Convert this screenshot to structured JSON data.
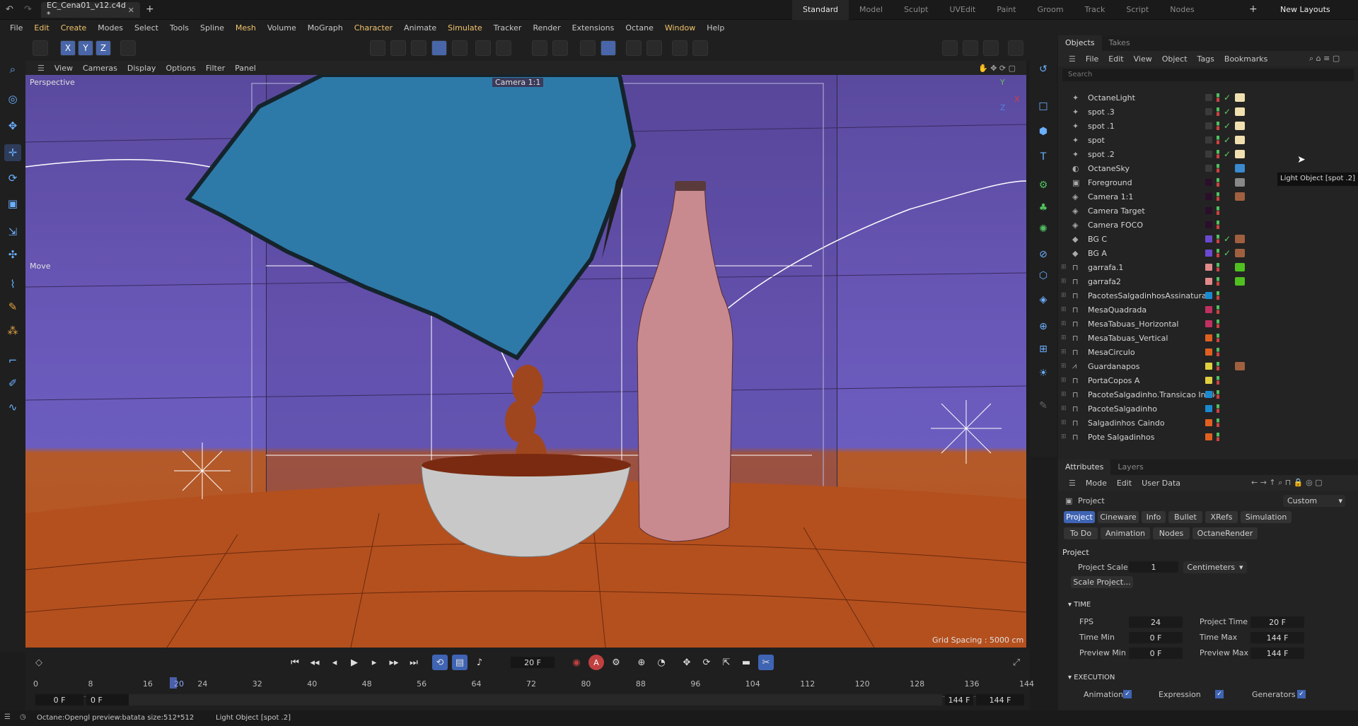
{
  "window": {
    "tab_title": "EC_Cena01_v12.c4d *",
    "new_layouts": "New Layouts"
  },
  "layouts": [
    "Standard",
    "Model",
    "Sculpt",
    "UVEdit",
    "Paint",
    "Groom",
    "Track",
    "Script",
    "Nodes"
  ],
  "menu": [
    "File",
    "Edit",
    "Create",
    "Modes",
    "Select",
    "Tools",
    "Spline",
    "Mesh",
    "Volume",
    "MoGraph",
    "Character",
    "Animate",
    "Simulate",
    "Tracker",
    "Render",
    "Extensions",
    "Octane",
    "Window",
    "Help"
  ],
  "axis_locks": [
    "X",
    "Y",
    "Z"
  ],
  "viewport": {
    "menu": [
      "View",
      "Cameras",
      "Display",
      "Options",
      "Filter",
      "Panel"
    ],
    "perspective": "Perspective",
    "camera": "Camera 1:1",
    "move": "Move",
    "grid_spacing": "Grid Spacing : 5000 cm",
    "axis_y": "Y",
    "axis_x": "X",
    "axis_z": "Z"
  },
  "objects_panel": {
    "tabs": [
      "Objects",
      "Takes"
    ],
    "menu": [
      "File",
      "Edit",
      "View",
      "Object",
      "Tags",
      "Bookmarks"
    ],
    "search_placeholder": "Search",
    "tooltip": "Light Object [spot .2]",
    "rows": [
      {
        "name": "OctaneLight",
        "color": "#3a3a3a"
      },
      {
        "name": "spot .3",
        "color": "#3a3a3a"
      },
      {
        "name": "spot .1",
        "color": "#3a3a3a"
      },
      {
        "name": "spot",
        "color": "#3a3a3a"
      },
      {
        "name": "spot .2",
        "color": "#3a3a3a"
      },
      {
        "name": "OctaneSky",
        "color": "#3a3a3a"
      },
      {
        "name": "Foreground",
        "color": "#2a0f2a"
      },
      {
        "name": "Camera 1:1",
        "color": "#2a0f2a"
      },
      {
        "name": "Camera Target",
        "color": "#2a0f2a"
      },
      {
        "name": "Camera FOCO",
        "color": "#2a0f2a"
      },
      {
        "name": "BG C",
        "color": "#6a4ad0"
      },
      {
        "name": "BG A",
        "color": "#6a4ad0"
      },
      {
        "name": "garrafa.1",
        "color": "#e08a8a"
      },
      {
        "name": "garrafa2",
        "color": "#e08a8a"
      },
      {
        "name": "PacotesSalgadinhosAssinatura",
        "color": "#1a8ad0"
      },
      {
        "name": "MesaQuadrada",
        "color": "#c03060"
      },
      {
        "name": "MesaTabuas_Horizontal",
        "color": "#c03060"
      },
      {
        "name": "MesaTabuas_Vertical",
        "color": "#e06020"
      },
      {
        "name": "MesaCirculo",
        "color": "#e06020"
      },
      {
        "name": "Guardanapos",
        "color": "#e0d040"
      },
      {
        "name": "PortaCopos A",
        "color": "#e0d040"
      },
      {
        "name": "PacoteSalgadinho.Transicao Inicio",
        "color": "#1a8ad0"
      },
      {
        "name": "PacoteSalgadinho",
        "color": "#1a8ad0"
      },
      {
        "name": "Salgadinhos Caindo",
        "color": "#e06020"
      },
      {
        "name": "Pote Salgadinhos",
        "color": "#e06020"
      }
    ]
  },
  "attributes": {
    "tabs": [
      "Attributes",
      "Layers"
    ],
    "menu": [
      "Mode",
      "Edit",
      "User Data"
    ],
    "object": "Project",
    "preset": "Custom",
    "buttons_row1": [
      "Project",
      "Cineware",
      "Info",
      "Bullet",
      "XRefs",
      "Simulation"
    ],
    "buttons_row2": [
      "To Do",
      "Animation",
      "Nodes",
      "OctaneRender"
    ],
    "section": "Project",
    "project_scale_label": "Project Scale",
    "project_scale": "1",
    "units": "Centimeters",
    "scale_project": "Scale Project...",
    "time_section": "TIME",
    "fps_label": "FPS",
    "fps": "24",
    "project_time_label": "Project Time",
    "project_time": "20 F",
    "time_min_label": "Time Min",
    "time_min": "0 F",
    "time_max_label": "Time Max",
    "time_max": "144 F",
    "preview_min_label": "Preview Min",
    "preview_min": "0 F",
    "preview_max_label": "Preview Max",
    "preview_max": "144 F",
    "execution_section": "EXECUTION",
    "animation_label": "Animation",
    "expression_label": "Expression",
    "generators_label": "Generators"
  },
  "timeline": {
    "current_frame": "20 F",
    "ticks": [
      "0",
      "8",
      "16",
      "24",
      "32",
      "40",
      "48",
      "56",
      "64",
      "72",
      "80",
      "88",
      "96",
      "104",
      "112",
      "120",
      "128",
      "136",
      "144"
    ],
    "playhead_label": "20",
    "start": "0 F",
    "start2": "0 F",
    "end": "144 F",
    "end2": "144 F"
  },
  "status": {
    "left": "Octane:Opengl preview:batata size:512*512",
    "right": "Light Object [spot .2]"
  }
}
